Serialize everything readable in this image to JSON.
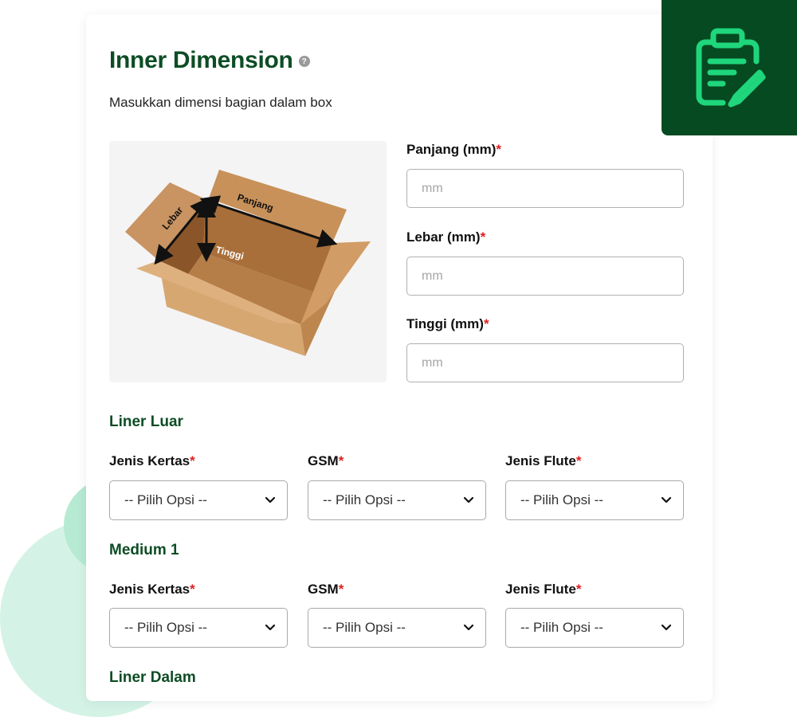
{
  "header": {
    "title": "Inner Dimension",
    "help_icon": "?",
    "subtitle": "Masukkan dimensi bagian dalam box"
  },
  "image": {
    "label_panjang": "Panjang",
    "label_lebar": "Lebar",
    "label_tinggi": "Tinggi"
  },
  "dimensions": [
    {
      "label": "Panjang (mm)",
      "required": "*",
      "placeholder": "mm"
    },
    {
      "label": "Lebar (mm)",
      "required": "*",
      "placeholder": "mm"
    },
    {
      "label": "Tinggi (mm)",
      "required": "*",
      "placeholder": "mm"
    }
  ],
  "sections": [
    {
      "title": "Liner Luar",
      "fields": [
        {
          "label": "Jenis Kertas",
          "required": "*",
          "value": "-- Pilih Opsi --"
        },
        {
          "label": "GSM",
          "required": "*",
          "value": "-- Pilih Opsi --"
        },
        {
          "label": "Jenis Flute",
          "required": "*",
          "value": "-- Pilih Opsi --"
        }
      ]
    },
    {
      "title": "Medium 1",
      "fields": [
        {
          "label": "Jenis Kertas",
          "required": "*",
          "value": "-- Pilih Opsi --"
        },
        {
          "label": "GSM",
          "required": "*",
          "value": "-- Pilih Opsi --"
        },
        {
          "label": "Jenis Flute",
          "required": "*",
          "value": "-- Pilih Opsi --"
        }
      ]
    },
    {
      "title": "Liner Dalam"
    }
  ],
  "colors": {
    "brand_dark": "#054a20",
    "heading_green": "#0d4d25",
    "icon_green": "#1fd67c",
    "required_red": "#e02020"
  },
  "icons": {
    "badge": "clipboard-edit-icon",
    "select": "chevron-down-icon",
    "help": "question-circle-icon"
  }
}
